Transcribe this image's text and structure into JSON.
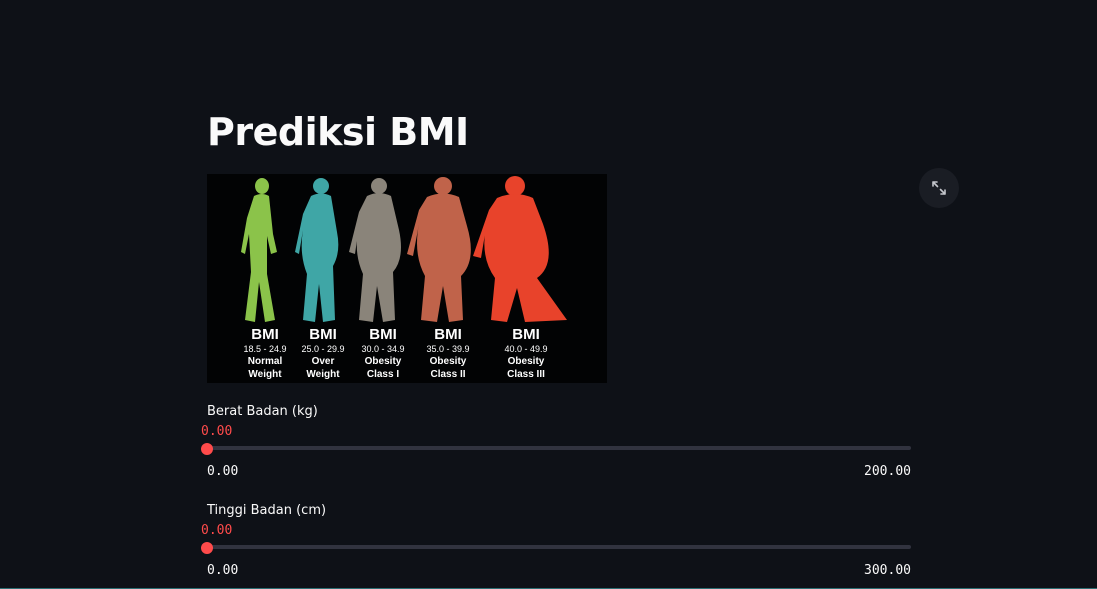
{
  "page": {
    "title": "Prediksi BMI"
  },
  "bmi_image": {
    "categories": [
      {
        "heading": "BMI",
        "range": "18.5 - 24.9",
        "line1": "Normal",
        "line2": "Weight",
        "color": "#8bc34a"
      },
      {
        "heading": "BMI",
        "range": "25.0 - 29.9",
        "line1": "Over",
        "line2": "Weight",
        "color": "#3fa6a6"
      },
      {
        "heading": "BMI",
        "range": "30.0 - 34.9",
        "line1": "Obesity",
        "line2": "Class I",
        "color": "#8a847a"
      },
      {
        "heading": "BMI",
        "range": "35.0 - 39.9",
        "line1": "Obesity",
        "line2": "Class II",
        "color": "#c0634a"
      },
      {
        "heading": "BMI",
        "range": "40.0 - 49.9",
        "line1": "Obesity",
        "line2": "Class III",
        "color": "#e8432b"
      }
    ]
  },
  "controls": {
    "expand_icon": "fullscreen-expand-icon"
  },
  "sliders": [
    {
      "label": "Berat Badan (kg)",
      "value": "0.00",
      "min": "0.00",
      "max": "200.00",
      "fraction": 0
    },
    {
      "label": "Tinggi Badan (cm)",
      "value": "0.00",
      "min": "0.00",
      "max": "300.00",
      "fraction": 0
    }
  ],
  "theme": {
    "background": "#0e1117",
    "accent": "#ff4b4b",
    "track": "#31333f",
    "text": "#fafafa"
  }
}
